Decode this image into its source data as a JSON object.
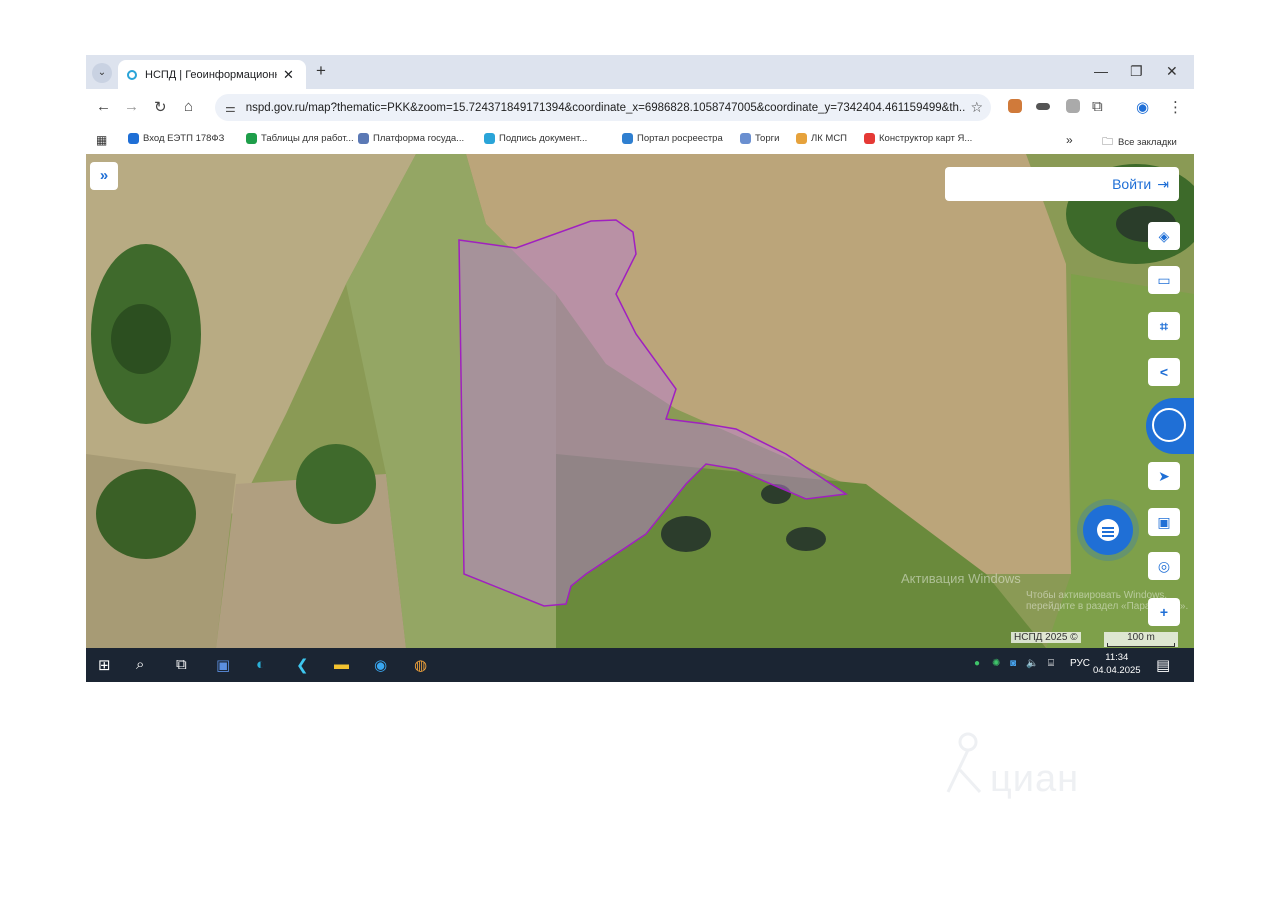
{
  "browser": {
    "tab_title": "НСПД | Геоинформационный",
    "tab_close": "✕",
    "new_tab": "+",
    "url": "nspd.gov.ru/map?thematic=PKK&zoom=15.724371849171394&coordinate_x=6986828.1058747005&coordinate_y=7342404.461159499&th...",
    "window_controls": [
      "—",
      "❐",
      "✕"
    ]
  },
  "bookmarks": [
    {
      "label": "Вход ЕЭТП 178ФЗ",
      "color": "#1f6fd6"
    },
    {
      "label": "Таблицы для работ...",
      "color": "#1e9e4a"
    },
    {
      "label": "Платформа госуда...",
      "color": "#5b79b5"
    },
    {
      "label": "Подпись документ...",
      "color": "#2aa4d8"
    },
    {
      "label": "Портал росреестра",
      "color": "#2f7fd0"
    },
    {
      "label": "Торги",
      "color": "#6a8fd0"
    },
    {
      "label": "ЛК МСП",
      "color": "#e6a23c"
    },
    {
      "label": "Конструктор карт Я...",
      "color": "#e53935"
    }
  ],
  "bookmarks_more": "»",
  "bookmarks_all": "Все закладки",
  "map": {
    "expand": "»",
    "login": "Войти",
    "copyright": "НСПД 2025 ©",
    "scale": "100 m",
    "watermark": "Активация Windows",
    "watermark_sub": "Чтобы активировать Windows, перейдите в раздел «Параметры»."
  },
  "taskbar": {
    "lang": "РУС",
    "time": "11:34",
    "date": "04.04.2025"
  },
  "watermark_brand": "циан"
}
